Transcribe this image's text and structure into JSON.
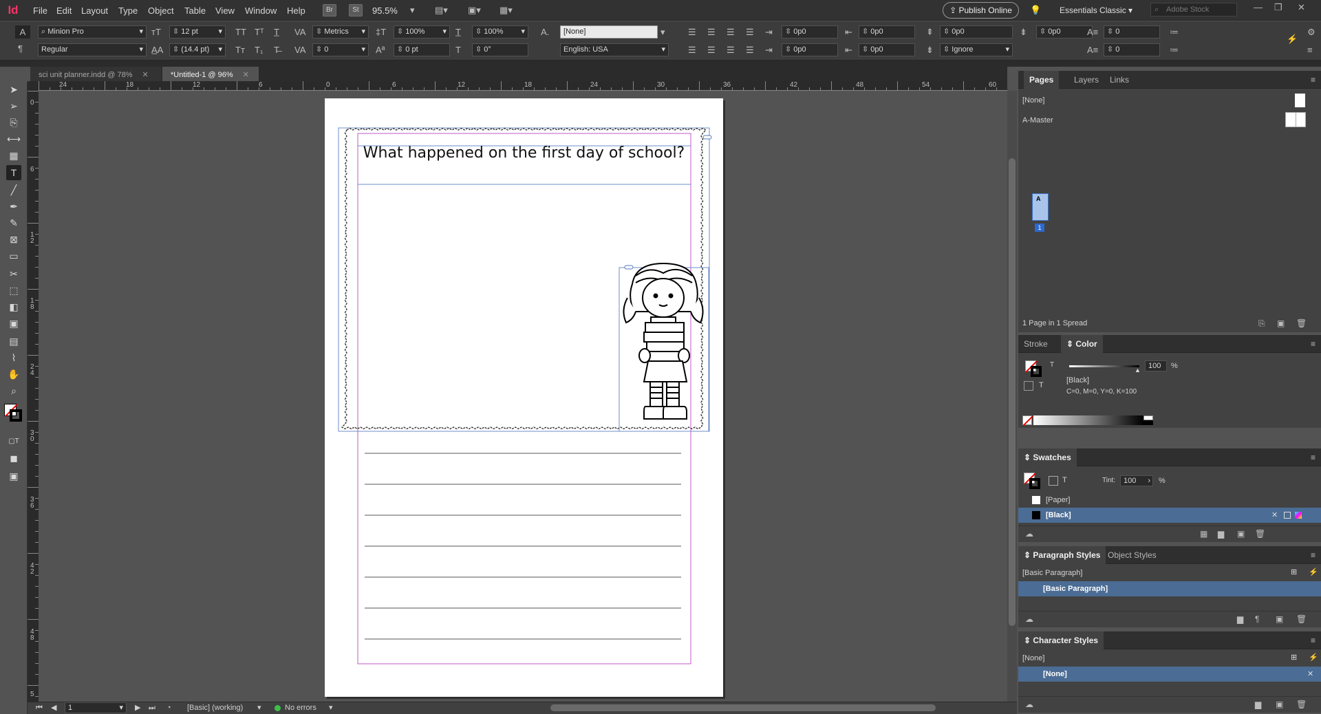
{
  "app": {
    "logo": "Id",
    "zoom": "95.5%",
    "bridge": "Br",
    "stock_chip": "St",
    "publish": "Publish Online",
    "workspace": "Essentials Classic",
    "search_placeholder": "Adobe Stock"
  },
  "menu": [
    "File",
    "Edit",
    "Layout",
    "Type",
    "Object",
    "Table",
    "View",
    "Window",
    "Help"
  ],
  "control": {
    "font_family": "Minion Pro",
    "font_style": "Regular",
    "font_size": "12 pt",
    "leading": "(14.4 pt)",
    "kerning": "Metrics",
    "tracking": "0",
    "vscale": "100%",
    "hscale": "100%",
    "baseline": "0 pt",
    "skew": "0°",
    "char_style": "[None]",
    "language": "English: USA",
    "indent_left": "0p0",
    "indent_right": "0p0",
    "first_indent": "0p0",
    "last_indent": "0p0",
    "space_before": "0p0",
    "space_after": "0p0",
    "drop_lines": "0",
    "drop_chars": "0",
    "hyphen": "Ignore"
  },
  "tabs": [
    {
      "label": "sci unit planner.indd @ 78%"
    },
    {
      "label": "*Untitled-1 @ 96%"
    }
  ],
  "ruler_h": [
    "24",
    "18",
    "12",
    "6",
    "0",
    "6",
    "12",
    "18",
    "24",
    "30",
    "36",
    "42",
    "48",
    "54",
    "60"
  ],
  "ruler_v": [
    "0",
    "6",
    "1 2",
    "1 8",
    "2 4",
    "3 0",
    "3 6",
    "4 2",
    "4 8",
    "5"
  ],
  "document": {
    "heading": "What happened on the first day of school?",
    "line_count": 7
  },
  "pages_panel": {
    "tabs": [
      "Pages",
      "Layers",
      "Links"
    ],
    "none": "[None]",
    "master": "A-Master",
    "page_num": "1",
    "master_letter": "A",
    "footer": "1 Page in 1 Spread"
  },
  "color_panel": {
    "tabs": [
      "Stroke",
      "Color"
    ],
    "t": "T",
    "tint": "100",
    "pct": "%",
    "name": "[Black]",
    "cmyk": "C=0, M=0, Y=0, K=100"
  },
  "swatches_panel": {
    "title": "Swatches",
    "tint_label": "Tint:",
    "tint": "100",
    "pct": "%",
    "items": [
      "[Paper]",
      "[Black]"
    ]
  },
  "para_panel": {
    "tabs": [
      "Paragraph Styles",
      "Object Styles"
    ],
    "current": "[Basic Paragraph]",
    "item": "[Basic Paragraph]"
  },
  "char_panel": {
    "title": "Character Styles",
    "current": "[None]",
    "item": "[None]"
  },
  "status": {
    "page": "1",
    "style": "[Basic] (working)",
    "errors": "No errors"
  }
}
